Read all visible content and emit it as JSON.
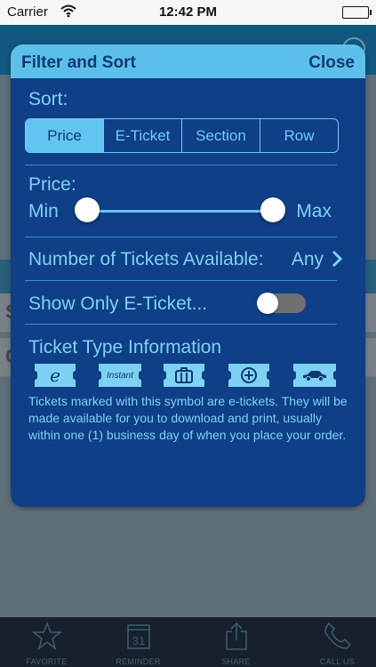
{
  "status_bar": {
    "carrier": "Carrier",
    "time": "12:42 PM",
    "battery_level": 1.0
  },
  "background": {
    "row1_letter": "S",
    "row2_letter": "C"
  },
  "modal": {
    "title": "Filter and Sort",
    "close_label": "Close",
    "sort_label": "Sort:",
    "sort_options": [
      "Price",
      "E-Ticket",
      "Section",
      "Row"
    ],
    "sort_selected": "Price",
    "price_label": "Price:",
    "price_min_label": "Min",
    "price_max_label": "Max",
    "price_range_fraction": [
      0.0,
      1.0
    ],
    "tickets_label": "Number of Tickets Available:",
    "tickets_value": "Any",
    "eticket_only_label": "Show Only E-Ticket...",
    "eticket_only_on": false,
    "ticket_type_label": "Ticket Type Information",
    "ticket_types": [
      {
        "icon": "e-ticket-icon",
        "text": "e"
      },
      {
        "icon": "instant-ticket-icon",
        "text": "Instant"
      },
      {
        "icon": "briefcase-icon",
        "text": ""
      },
      {
        "icon": "plus-circle-icon",
        "text": ""
      },
      {
        "icon": "car-icon",
        "text": ""
      }
    ],
    "info_text": "Tickets marked with this symbol are e-tickets. They will be made available for you to download and print, usually within one (1) business day of when you place your order."
  },
  "tab_bar": {
    "items": [
      {
        "label": "FAVORITE",
        "icon": "star-icon"
      },
      {
        "label": "REMINDER",
        "icon": "calendar-icon",
        "icon_text": "31"
      },
      {
        "label": "SHARE",
        "icon": "share-icon"
      },
      {
        "label": "CALL US",
        "icon": "phone-icon"
      }
    ]
  },
  "colors": {
    "modal_bg": "#0f3f86",
    "accent": "#62c5ef",
    "text_accent": "#7fd1f4",
    "header_text": "#0d3a73"
  }
}
